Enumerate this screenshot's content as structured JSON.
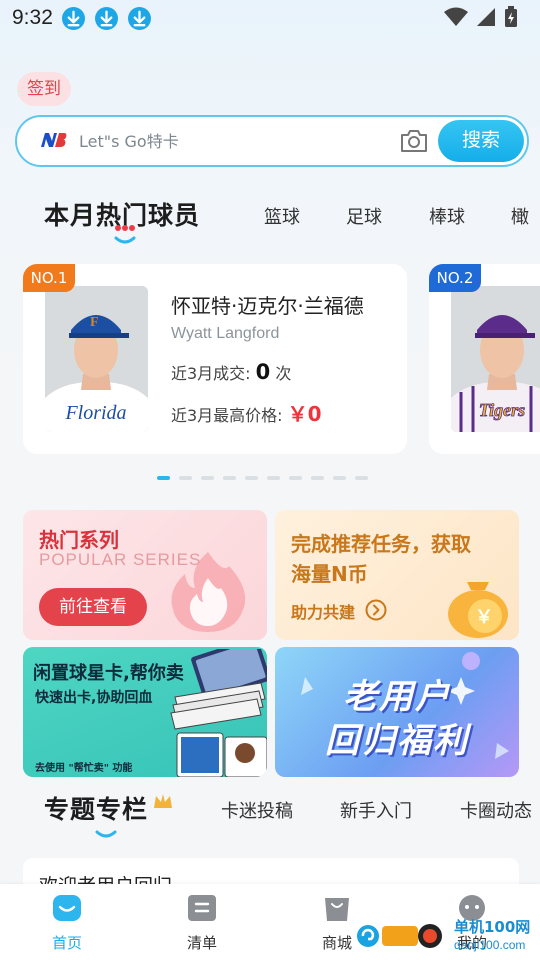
{
  "status_bar": {
    "time": "9:32"
  },
  "checkin": {
    "label": "签到"
  },
  "search": {
    "placeholder": "Let\"s Go特卡",
    "button_label": "搜索"
  },
  "hot_players": {
    "title": "本月热门球员",
    "tabs": [
      "篮球",
      "足球",
      "棒球",
      "橄"
    ],
    "cards": [
      {
        "rank": "NO.1",
        "name": "怀亚特·迈克尔·兰福德",
        "english_name": "Wyatt Langford",
        "deals_label": "近3月成交:",
        "deals_count": "0",
        "deals_unit": "次",
        "price_label": "近3月最高价格:",
        "price": "￥0",
        "jersey_text": "Florida"
      },
      {
        "rank": "NO.2",
        "jersey_text": "Tigers"
      }
    ],
    "page_dots": 10,
    "active_dot": 0
  },
  "promos": {
    "hot_series": {
      "title": "热门系列",
      "subtitle": "POPULAR SERIES",
      "button": "前往查看"
    },
    "task": {
      "title_line1": "完成推荐任务，获取",
      "title_line2": "海量N币",
      "link": "助力共建",
      "coin_symbol": "￥"
    },
    "sell": {
      "title": "闲置球星卡,帮你卖",
      "subtitle": "快速出卡,协助回血",
      "note": "去使用 \"帮忙卖\" 功能"
    },
    "return": {
      "line1": "老用户",
      "line2": "回归福利"
    }
  },
  "topics": {
    "title": "专题专栏",
    "tabs": [
      "卡迷投稿",
      "新手入门",
      "卡圈动态"
    ],
    "preview_text": "欢迎老用户回归"
  },
  "bottom_nav": [
    {
      "label": "首页",
      "active": true
    },
    {
      "label": "清单",
      "active": false
    },
    {
      "label": "商城",
      "active": false
    },
    {
      "label": "我的",
      "active": false
    }
  ],
  "watermark": {
    "text": "单机100网",
    "url": "danji100.com"
  },
  "colors": {
    "accent": "#1aaee8",
    "price_red": "#f0323a",
    "rank1": "#f07a1c",
    "rank2": "#1e6ad6"
  }
}
